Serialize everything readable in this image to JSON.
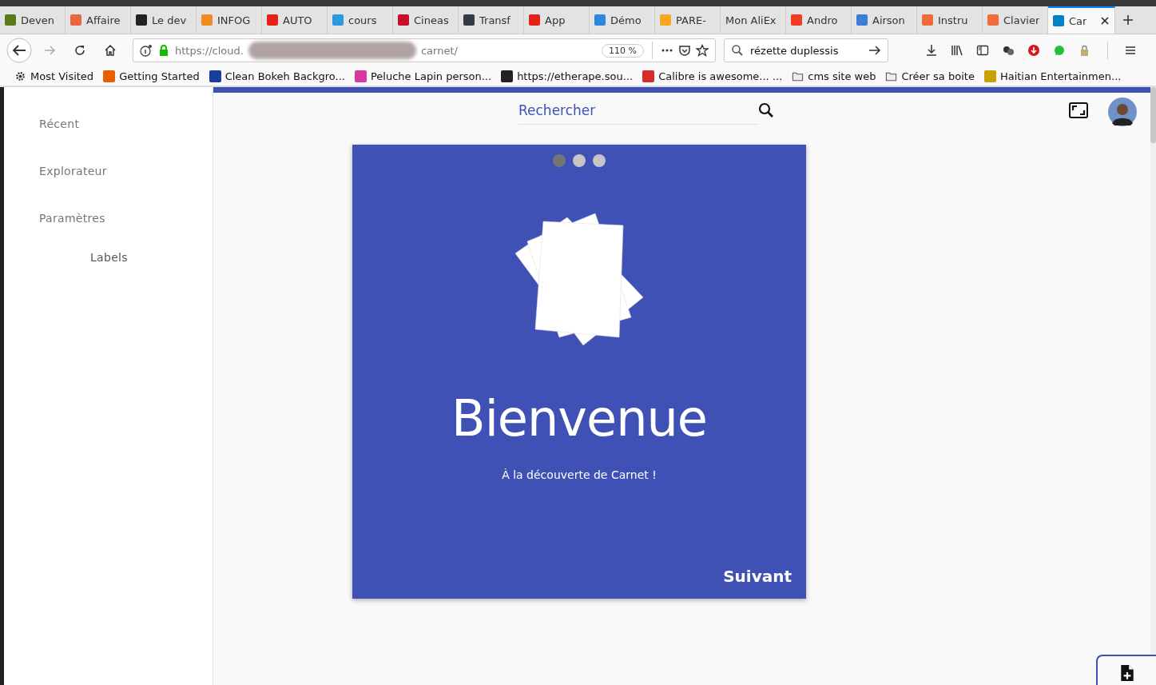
{
  "tabs": [
    {
      "title": "Deven",
      "color": "#5a7a1a",
      "selected": false
    },
    {
      "title": "Affaire",
      "color": "#e8663d",
      "selected": false
    },
    {
      "title": "Le dev",
      "color": "#222222",
      "selected": false
    },
    {
      "title": "INFOG",
      "color": "#f08a24",
      "selected": false
    },
    {
      "title": "AUTO",
      "color": "#e62117",
      "selected": false
    },
    {
      "title": "cours",
      "color": "#2b9ae0",
      "selected": false
    },
    {
      "title": "Cineas",
      "color": "#c8102e",
      "selected": false
    },
    {
      "title": "Transf",
      "color": "#333b44",
      "selected": false
    },
    {
      "title": "App",
      "color": "#e62117",
      "selected": false
    },
    {
      "title": "Démo",
      "color": "#2e86de",
      "selected": false
    },
    {
      "title": "PARE-",
      "color": "#f5a623",
      "selected": false
    },
    {
      "title": "Mon AliEx",
      "selected": false
    },
    {
      "title": "Andro",
      "color": "#ee3d24",
      "selected": false
    },
    {
      "title": "Airson",
      "color": "#3b7dd8",
      "selected": false
    },
    {
      "title": "Instru",
      "color": "#f26b3a",
      "selected": false
    },
    {
      "title": "Clavier",
      "color": "#f26b3a",
      "selected": false
    },
    {
      "title": "Car",
      "color": "#0082c9",
      "selected": true
    }
  ],
  "address": {
    "start": "https://cloud.",
    "end": "carnet/",
    "zoom": "110 %"
  },
  "search": {
    "value": "rézette duplessis"
  },
  "bookmarks": [
    {
      "label": "Most Visited",
      "kind": "gear"
    },
    {
      "label": "Getting Started",
      "kind": "site",
      "color": "#e66000"
    },
    {
      "label": "Clean Bokeh Backgro...",
      "kind": "site",
      "color": "#1a3d9c"
    },
    {
      "label": "Peluche Lapin person...",
      "kind": "site",
      "color": "#d63aa0"
    },
    {
      "label": "https://etherape.sou...",
      "kind": "site",
      "color": "#222222"
    },
    {
      "label": "Calibre is awesome... ...",
      "kind": "site",
      "color": "#d62b2b"
    },
    {
      "label": "cms site web",
      "kind": "folder"
    },
    {
      "label": "Créer sa boite",
      "kind": "folder"
    },
    {
      "label": "Haitian Entertainmen...",
      "kind": "site",
      "color": "#c8a000"
    }
  ],
  "sidebar": {
    "items": [
      {
        "label": "Récent",
        "kind": "main"
      },
      {
        "label": "Explorateur",
        "kind": "main"
      },
      {
        "label": "Paramètres",
        "kind": "main"
      },
      {
        "label": "Labels",
        "kind": "sub"
      }
    ]
  },
  "header": {
    "search": {
      "placeholder": "Rechercher"
    }
  },
  "onboarding": {
    "dots": [
      {
        "selected": true
      },
      {
        "selected": false
      },
      {
        "selected": false
      }
    ],
    "title": "Bienvenue",
    "subtitle": "À la découverte de Carnet !",
    "next": "Suivant"
  }
}
